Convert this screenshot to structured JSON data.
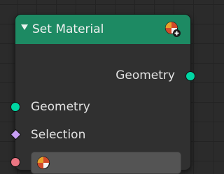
{
  "node": {
    "title": "Set Material",
    "header_color": "#1d8a63",
    "outputs": [
      {
        "label": "Geometry",
        "socket_color": "#00d6a3"
      }
    ],
    "inputs": [
      {
        "label": "Geometry",
        "socket_color": "#00d6a3"
      },
      {
        "label": "Selection",
        "socket_color": "#c89ff5"
      },
      {
        "label": "",
        "socket_color": "#eb7582",
        "field_icon": "material-icon"
      }
    ],
    "header_icon": "material-add-icon",
    "collapse_icon": "triangle-down-icon"
  }
}
